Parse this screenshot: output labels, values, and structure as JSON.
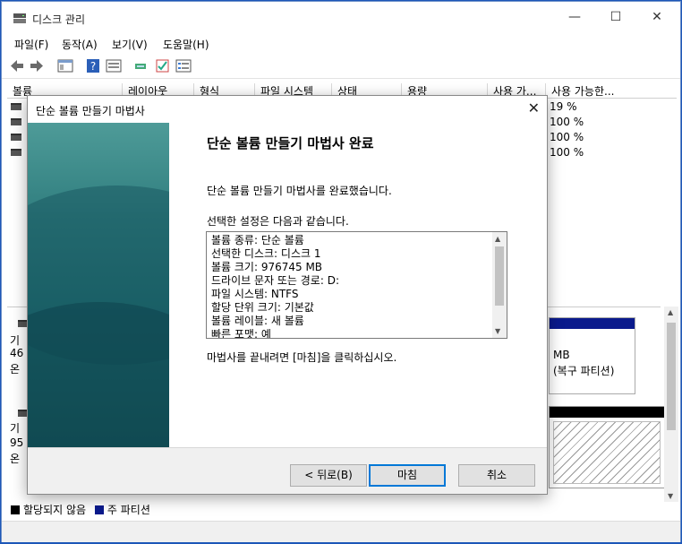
{
  "window": {
    "title": "디스크 관리",
    "min": "—",
    "max": "☐",
    "close": "✕"
  },
  "menu": [
    "파일(F)",
    "동작(A)",
    "보기(V)",
    "도움말(H)"
  ],
  "columns": [
    "볼륨",
    "레이아웃",
    "형식",
    "파일 시스템",
    "상태",
    "용량",
    "사용 가...",
    "사용 가능한..."
  ],
  "volumes_pct": [
    "19 %",
    "100 %",
    "100 %",
    "100 %"
  ],
  "disks": [
    {
      "line1": "기",
      "line2": "46",
      "line3": "온"
    },
    {
      "line1": "기",
      "line2": "95",
      "line3": "온"
    }
  ],
  "partition": {
    "size": "MB",
    "desc": "(복구 파티션)"
  },
  "legend": {
    "unallocated": "할당되지 않음",
    "primary": "주 파티션",
    "unalloc_color": "#000000",
    "primary_color": "#0a1a8c"
  },
  "dialog": {
    "title": "단순 볼륨 만들기 마법사",
    "close": "✕",
    "heading": "단순 볼륨 만들기 마법사 완료",
    "p1": "단순 볼륨 만들기 마법사를 완료했습니다.",
    "p2": "선택한 설정은 다음과 같습니다.",
    "summary": [
      "볼륨 종류: 단순 볼륨",
      "선택한 디스크: 디스크 1",
      "볼륨 크기: 976745 MB",
      "드라이브 문자 또는 경로: D:",
      "파일 시스템: NTFS",
      "할당 단위 크기: 기본값",
      "볼륨 레이블: 새 볼륨",
      "빠른 포맷: 예"
    ],
    "p3": "마법사를 끝내려면 [마침]을 클릭하십시오.",
    "back": "< 뒤로(B)",
    "finish": "마침",
    "cancel": "취소"
  }
}
